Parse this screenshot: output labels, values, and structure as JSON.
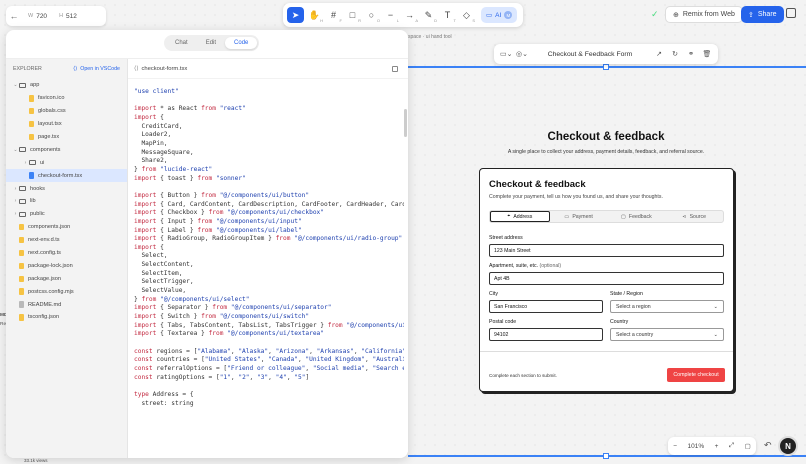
{
  "canvas": {
    "width_value": "720",
    "height_value": "512",
    "width_label": "W",
    "height_label": "H",
    "breadcrumb": "space  ·  ui hand tool"
  },
  "toolbar": {
    "ai_label": "AI",
    "ai_dot": "M",
    "remix_label": "Remix from Web",
    "share_label": "Share"
  },
  "panel": {
    "mode_tabs": [
      "Chat",
      "Edit",
      "Code"
    ],
    "active_mode": "Code",
    "explorer_title": "EXPLORER",
    "open_vscode": "Open in VSCode",
    "tree": [
      {
        "label": "app",
        "type": "folder",
        "depth": 0,
        "open": true
      },
      {
        "label": "favicon.ico",
        "type": "file",
        "depth": 1
      },
      {
        "label": "globals.css",
        "type": "file",
        "depth": 1
      },
      {
        "label": "layout.tsx",
        "type": "file",
        "depth": 1
      },
      {
        "label": "page.tsx",
        "type": "file",
        "depth": 1
      },
      {
        "label": "components",
        "type": "folder",
        "depth": 0,
        "open": true
      },
      {
        "label": "ui",
        "type": "folder",
        "depth": 1,
        "open": false
      },
      {
        "label": "checkout-form.tsx",
        "type": "file",
        "depth": 1,
        "selected": true
      },
      {
        "label": "hooks",
        "type": "folder",
        "depth": 0
      },
      {
        "label": "lib",
        "type": "folder",
        "depth": 0
      },
      {
        "label": "public",
        "type": "folder",
        "depth": 0
      },
      {
        "label": "components.json",
        "type": "file",
        "depth": 0
      },
      {
        "label": "next-env.d.ts",
        "type": "file",
        "depth": 0
      },
      {
        "label": "next.config.ts",
        "type": "file",
        "depth": 0
      },
      {
        "label": "package-lock.json",
        "type": "file",
        "depth": 0
      },
      {
        "label": "package.json",
        "type": "file",
        "depth": 0
      },
      {
        "label": "postcss.config.mjs",
        "type": "file",
        "depth": 0
      },
      {
        "label": "README.md",
        "type": "file",
        "depth": 0
      },
      {
        "label": "tsconfig.json",
        "type": "file",
        "depth": 0
      }
    ],
    "open_file": "checkout-form.tsx",
    "code_lines": [
      "\"use client\"",
      "",
      "import * as React from \"react\"",
      "import {",
      "  CreditCard,",
      "  Loader2,",
      "  MapPin,",
      "  MessageSquare,",
      "  Share2,",
      "} from \"lucide-react\"",
      "import { toast } from \"sonner\"",
      "",
      "import { Button } from \"@/components/ui/button\"",
      "import { Card, CardContent, CardDescription, CardFooter, CardHeader, CardT",
      "import { Checkbox } from \"@/components/ui/checkbox\"",
      "import { Input } from \"@/components/ui/input\"",
      "import { Label } from \"@/components/ui/label\"",
      "import { RadioGroup, RadioGroupItem } from \"@/components/ui/radio-group\"",
      "import {",
      "  Select,",
      "  SelectContent,",
      "  SelectItem,",
      "  SelectTrigger,",
      "  SelectValue,",
      "} from \"@/components/ui/select\"",
      "import { Separator } from \"@/components/ui/separator\"",
      "import { Switch } from \"@/components/ui/switch\"",
      "import { Tabs, TabsContent, TabsList, TabsTrigger } from \"@/components/ui/",
      "import { Textarea } from \"@/components/ui/textarea\"",
      "",
      "const regions = [\"Alabama\", \"Alaska\", \"Arizona\", \"Arkansas\", \"California\",",
      "const countries = [\"United States\", \"Canada\", \"United Kingdom\", \"Australia",
      "const referralOptions = [\"Friend or colleague\", \"Social media\", \"Search en",
      "const ratingOptions = [\"1\", \"2\", \"3\", \"4\", \"5\"]",
      "",
      "type Address = {",
      "  street: string"
    ]
  },
  "element_toolbar": {
    "title": "Checkout & Feedback Form"
  },
  "background_left": {
    "text_1": "MD",
    "text_2": "Re",
    "views": "33.1k views"
  },
  "preview": {
    "page_title": "Checkout & feedback",
    "page_subtitle": "A single place to collect your address, payment details, feedback, and referral source.",
    "card_title": "Checkout & feedback",
    "card_description": "Complete your payment, tell us how you found us, and share your thoughts.",
    "tabs": [
      "Address",
      "Payment",
      "Feedback",
      "Source"
    ],
    "active_tab": "Address",
    "street_label": "Street address",
    "street_value": "123 Main Street",
    "apt_label": "Apartment, suite, etc.",
    "apt_optional": "(optional)",
    "apt_value": "Apt 4B",
    "city_label": "City",
    "city_value": "San Francisco",
    "state_label": "State / Region",
    "state_placeholder": "Select a region",
    "postal_label": "Postal code",
    "postal_value": "94102",
    "country_label": "Country",
    "country_placeholder": "Select a country",
    "footer_text": "Complete each section to submit.",
    "complete_button": "Complete checkout"
  },
  "zoom": {
    "minus": "−",
    "level": "101%",
    "plus": "+"
  },
  "avatar_letter": "N",
  "colors": {
    "accent": "#2563eb",
    "primary_button": "#ef4444"
  }
}
